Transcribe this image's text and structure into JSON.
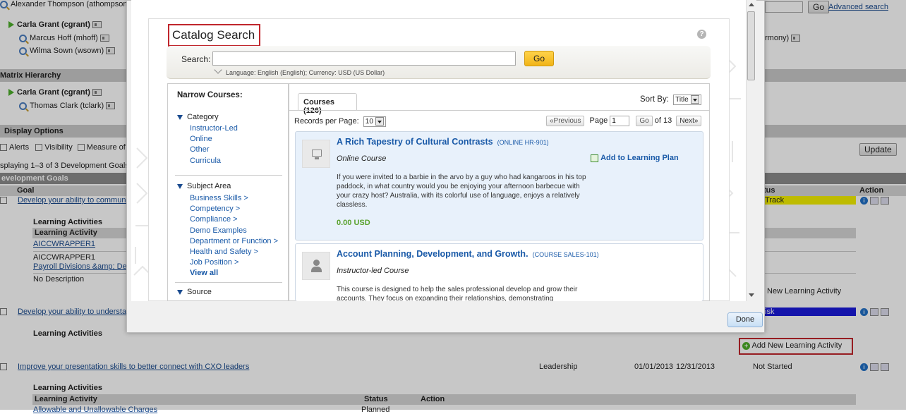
{
  "bg": {
    "users_top": [
      "Alexander Thompson (athompson)"
    ],
    "carla1": "Carla Grant (cgrant)",
    "marcus": "Marcus Hoff (mhoff)",
    "wilma": "Wilma Sown (wsown)",
    "matrix_hierarchy": "Matrix Hierarchy",
    "carla2": "Carla Grant (cgrant)",
    "thomas": "Thomas Clark (tclark)",
    "display_options": "Display Options",
    "alerts": "Alerts",
    "visibility": "Visibility",
    "measure": "Measure of Su",
    "displaying": "splaying 1–3 of 3 Development Goals",
    "update_btn": "Update",
    "dev_goals": "evelopment Goals",
    "goal_col": "Goal",
    "status_col": "tus",
    "action_col": "Action",
    "goal1": "Develop your ability to communic",
    "learning_activities": "Learning Activities",
    "learning_activity": "Learning Activity",
    "la1": "AICCWRAPPER1",
    "la2": "AICCWRAPPER1",
    "la3": "Payroll Divisions &amp; Dep",
    "la4": "No Description",
    "track": "Track",
    "add_new_la_right": "New Learning Activity",
    "goal2": "Develop your ability to understan",
    "risk": "isk",
    "learning_activities2": "Learning Activities",
    "add_new_la": "Add New Learning Activity",
    "goal3": "Improve your presentation skills to better connect with CXO leaders",
    "goal3_cat": "Leadership",
    "goal3_start": "01/01/2013",
    "goal3_end": "12/31/2013",
    "goal3_status": "Not Started",
    "learning_activities3": "Learning Activities",
    "la_header": "Learning Activity",
    "status_header": "Status",
    "action_header": "Action",
    "la5": "Allowable and Unallowable Charges",
    "planned": "Planned",
    "go_top": "Go",
    "advanced_search": "Advanced search",
    "harmony": "rmony)"
  },
  "modal": {
    "title": "Catalog Search",
    "search_label": "Search:",
    "search_value": "",
    "go": "Go",
    "language_info": "Language: English (English); Currency: USD (US Dollar)",
    "narrow_title": "Narrow Courses:",
    "category_label": "Category",
    "category_items": [
      "Instructor-Led",
      "Online",
      "Other",
      "Curricula"
    ],
    "subject_label": "Subject Area",
    "subject_items": [
      "Business Skills >",
      "Competency >",
      "Compliance >",
      "Demo Examples",
      "Department or Function >",
      "Health and Safety >",
      "Job Position >"
    ],
    "view_all": "View all",
    "source_label": "Source",
    "courses_tab": "Courses (126)",
    "sort_by": "Sort By:",
    "sort_value": "Title",
    "records_per_page": "Records per Page:",
    "records_value": "10",
    "previous": "«Previous",
    "page_label": "Page",
    "page_value": "1",
    "go_page": "Go",
    "of_pages": "of 13",
    "next": "Next»",
    "course1": {
      "title": "A Rich Tapestry of Cultural Contrasts",
      "code": "(ONLINE HR-901)",
      "type": "Online Course",
      "add_plan": "Add to Learning Plan",
      "description": "If you were invited to a barbie in the arvo by a guy who had kangaroos in his top paddock, in what country would you be enjoying your afternoon barbecue with your crazy host? Australia, with its colorful use of language, enjoys a relatively classless.",
      "price": "0.00 USD"
    },
    "course2": {
      "title": "Account Planning, Development, and Growth.",
      "code": "(COURSE SALES-101)",
      "type": "Instructor-led Course",
      "description": "This course is designed to help the sales professional develop and grow their accounts. They focus on expanding their relationships, demonstrating"
    },
    "done": "Done"
  },
  "colors": {
    "track": "#f4f000",
    "risk": "#1a1adb",
    "accent": "#1a5aa8",
    "go_yellow": "#f1b418"
  }
}
